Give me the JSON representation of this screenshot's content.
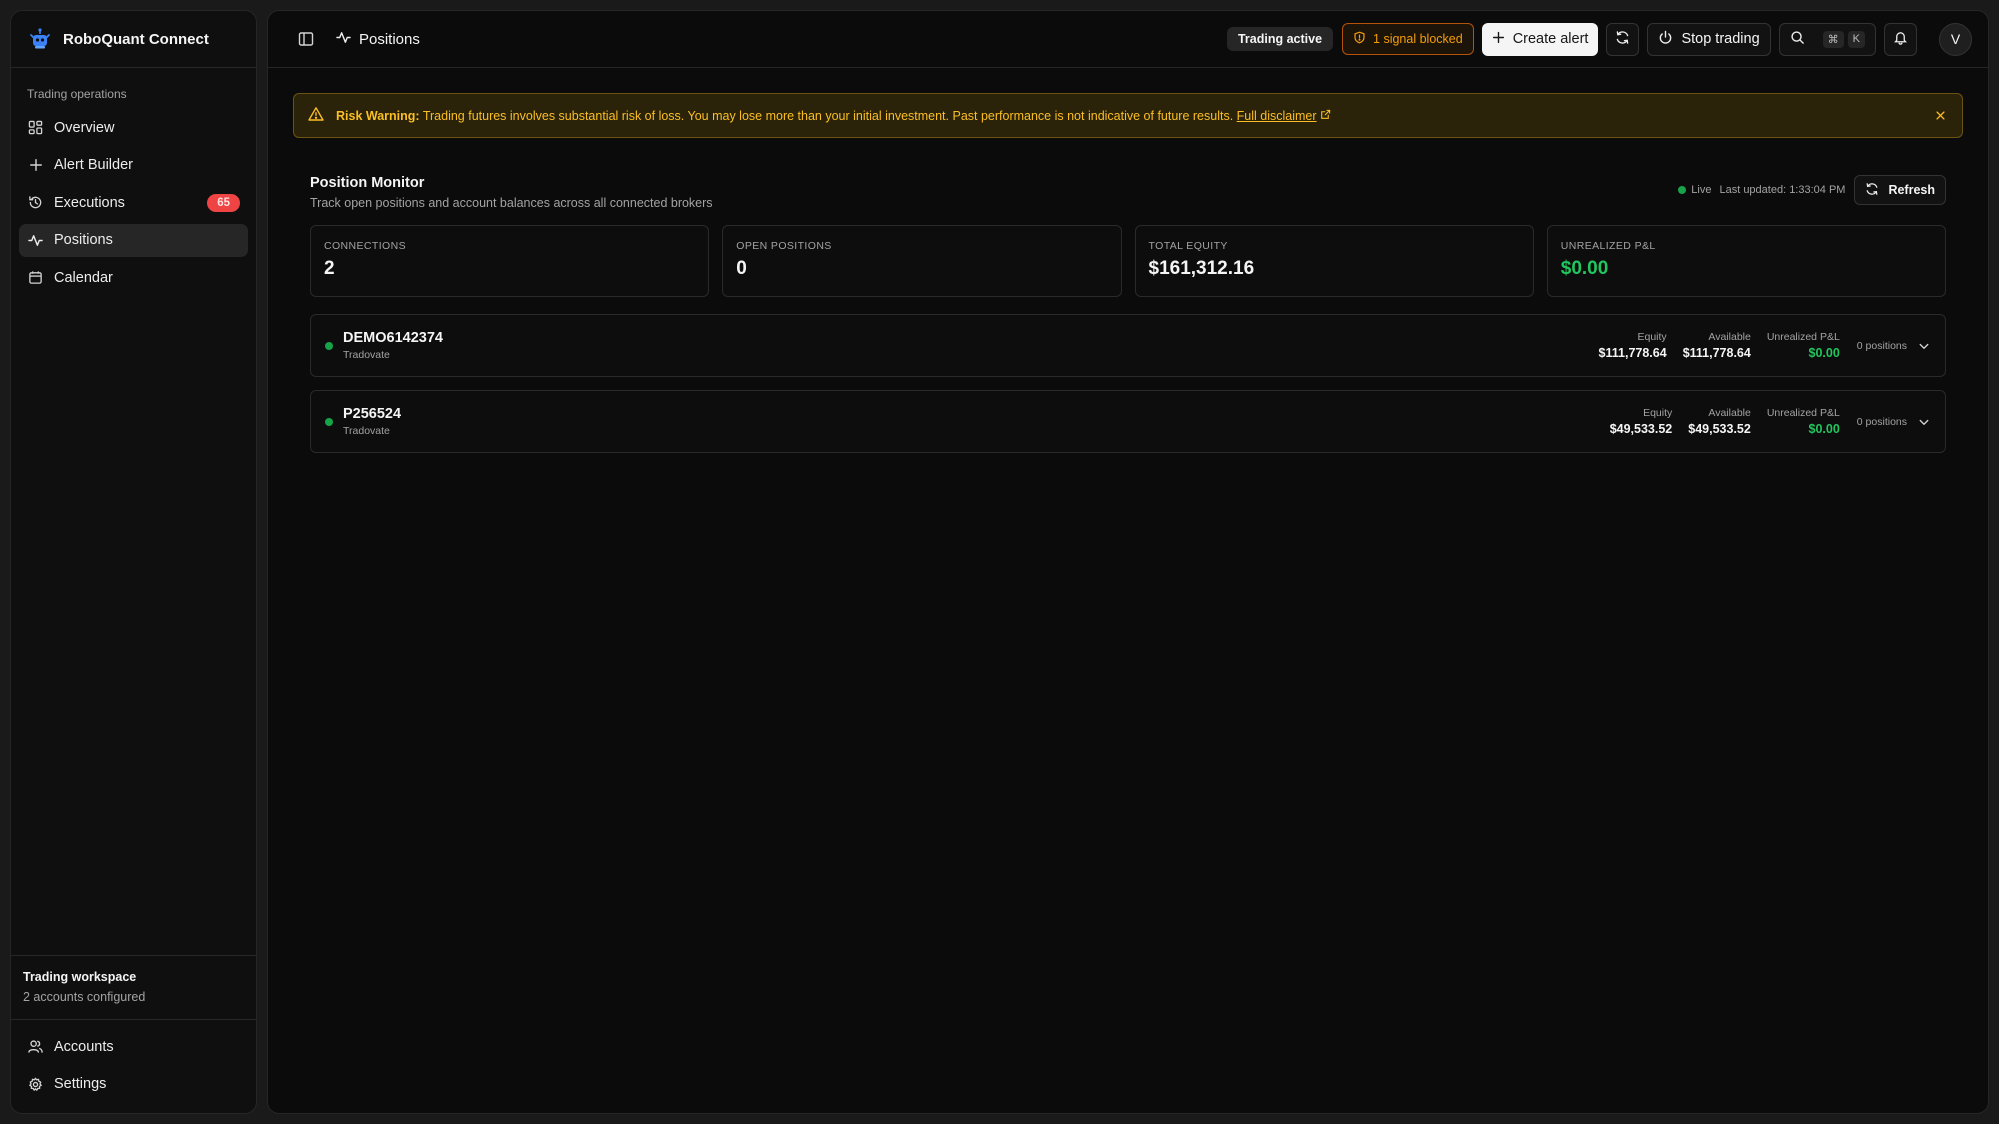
{
  "app": {
    "name": "RoboQuant Connect"
  },
  "sidebar": {
    "section_heading": "Trading operations",
    "items": [
      {
        "label": "Overview",
        "icon": "grid-icon"
      },
      {
        "label": "Alert Builder",
        "icon": "plus-icon"
      },
      {
        "label": "Executions",
        "icon": "history-icon",
        "badge": "65"
      },
      {
        "label": "Positions",
        "icon": "activity-icon",
        "active": true
      },
      {
        "label": "Calendar",
        "icon": "calendar-icon"
      }
    ],
    "workspace": {
      "title": "Trading workspace",
      "subtitle": "2 accounts configured"
    },
    "bottom_items": [
      {
        "label": "Accounts",
        "icon": "users-icon"
      },
      {
        "label": "Settings",
        "icon": "gear-icon"
      }
    ]
  },
  "topbar": {
    "breadcrumb": "Positions",
    "status": "Trading active",
    "signal_blocked": "1 signal blocked",
    "create_alert": "Create alert",
    "stop_trading": "Stop trading",
    "shortcut": [
      "⌘",
      "K"
    ],
    "avatar_initial": "V"
  },
  "risk_warning": {
    "label": "Risk Warning:",
    "text": "Trading futures involves substantial risk of loss. You may lose more than your initial investment. Past performance is not indicative of future results.",
    "link": "Full disclaimer"
  },
  "monitor": {
    "title": "Position Monitor",
    "subtitle": "Track open positions and account balances across all connected brokers",
    "live": "Live",
    "last_updated": "Last updated: 1:33:04 PM",
    "refresh": "Refresh"
  },
  "stats": [
    {
      "label": "CONNECTIONS",
      "value": "2"
    },
    {
      "label": "OPEN POSITIONS",
      "value": "0"
    },
    {
      "label": "TOTAL EQUITY",
      "value": "$161,312.16"
    },
    {
      "label": "UNREALIZED P&L",
      "value": "$0.00"
    }
  ],
  "accounts": [
    {
      "id": "DEMO6142374",
      "broker": "Tradovate",
      "equity_label": "Equity",
      "equity": "$111,778.64",
      "available_label": "Available",
      "available": "$111,778.64",
      "pnl_label": "Unrealized P&L",
      "pnl": "$0.00",
      "positions": "0 positions"
    },
    {
      "id": "P256524",
      "broker": "Tradovate",
      "equity_label": "Equity",
      "equity": "$49,533.52",
      "available_label": "Available",
      "available": "$49,533.52",
      "pnl_label": "Unrealized P&L",
      "pnl": "$0.00",
      "positions": "0 positions"
    }
  ],
  "colors": {
    "accent_green": "#22c55e",
    "badge_red": "#ef4444",
    "warning_amber": "#fbbf24",
    "brand_blue": "#3b82f6"
  }
}
